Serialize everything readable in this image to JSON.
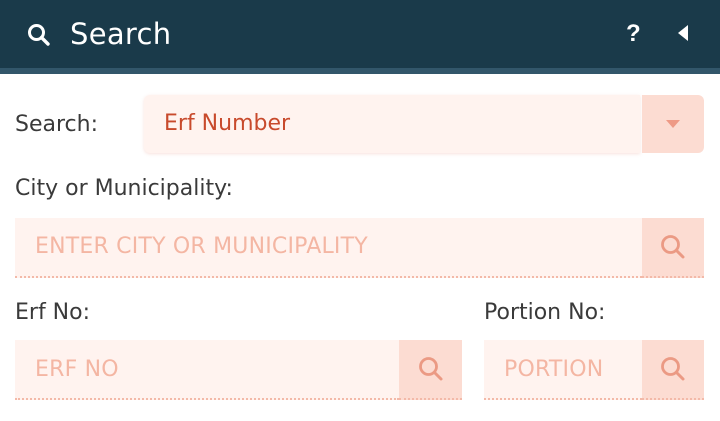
{
  "header": {
    "title": "Search",
    "help_label": "?"
  },
  "form": {
    "search_type": {
      "label": "Search:",
      "selected": "Erf Number"
    },
    "city": {
      "label": "City or Municipality:",
      "placeholder": "ENTER CITY OR MUNICIPALITY"
    },
    "erf": {
      "label": "Erf No:",
      "placeholder": "ERF NO"
    },
    "portion": {
      "label": "Portion No:",
      "placeholder": "PORTION"
    }
  },
  "colors": {
    "header_bg": "#1a3a4a",
    "accent": "#c84a2c",
    "field_bg": "#fff3ef",
    "button_bg": "#fcdcd2",
    "placeholder": "#f4b6a3"
  },
  "icons": {
    "header_search": "search-icon",
    "header_back": "back-arrow-icon",
    "dropdown": "chevron-down-icon",
    "field_search": "search-icon"
  }
}
